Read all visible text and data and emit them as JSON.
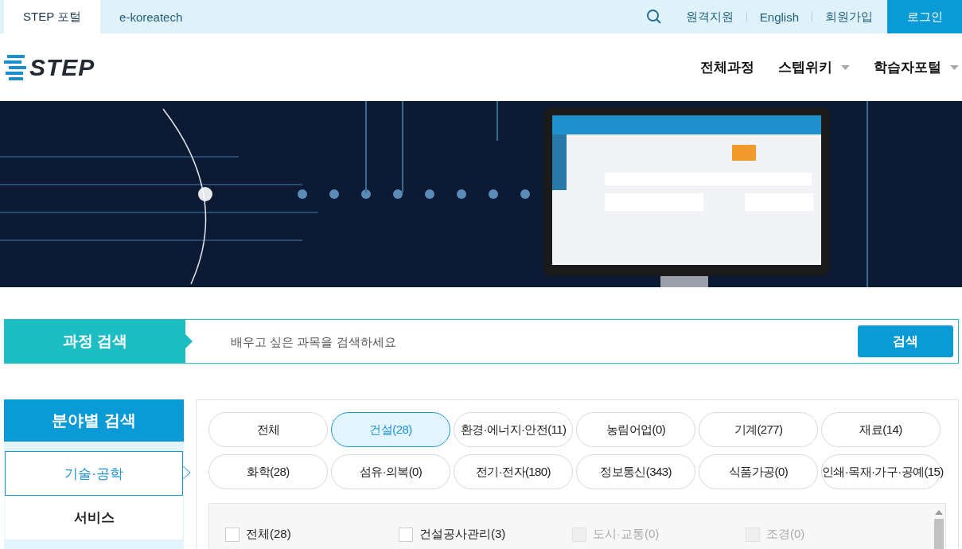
{
  "top_bar": {
    "tabs": [
      {
        "label": "STEP 포털",
        "selected": true
      },
      {
        "label": "e-koreatech",
        "selected": false
      }
    ],
    "links": [
      "원격지원",
      "English",
      "회원가입"
    ],
    "login": "로그인"
  },
  "header": {
    "logo": "STEP",
    "nav": [
      {
        "label": "전체과정",
        "dropdown": false
      },
      {
        "label": "스텝위키",
        "dropdown": true
      },
      {
        "label": "학습자포털",
        "dropdown": true
      }
    ]
  },
  "course_search": {
    "label": "과정 검색",
    "placeholder": "배우고 싶은 과목을 검색하세요",
    "button": "검색"
  },
  "field_search": {
    "title": "분야별 검색",
    "categories": [
      {
        "label": "기술·공학",
        "selected": true
      },
      {
        "label": "서비스",
        "selected": false
      }
    ],
    "chips": [
      {
        "label": "전체",
        "selected": false
      },
      {
        "label": "건설(28)",
        "selected": true
      },
      {
        "label": "환경·에너지·안전(11)",
        "selected": false
      },
      {
        "label": "농림어업(0)",
        "selected": false
      },
      {
        "label": "기계(277)",
        "selected": false
      },
      {
        "label": "재료(14)",
        "selected": false
      },
      {
        "label": "화학(28)",
        "selected": false
      },
      {
        "label": "섬유·의복(0)",
        "selected": false
      },
      {
        "label": "전기·전자(180)",
        "selected": false
      },
      {
        "label": "정보통신(343)",
        "selected": false
      },
      {
        "label": "식품가공(0)",
        "selected": false
      },
      {
        "label": "인쇄·목재·가구·공예(15)",
        "selected": false
      }
    ],
    "subfields": [
      {
        "label": "전체(28)",
        "checked": false,
        "disabled": false
      },
      {
        "label": "건설공사관리(3)",
        "checked": false,
        "disabled": false
      },
      {
        "label": "도시·교통(0)",
        "checked": false,
        "disabled": true
      },
      {
        "label": "조경(0)",
        "checked": false,
        "disabled": true
      }
    ]
  }
}
